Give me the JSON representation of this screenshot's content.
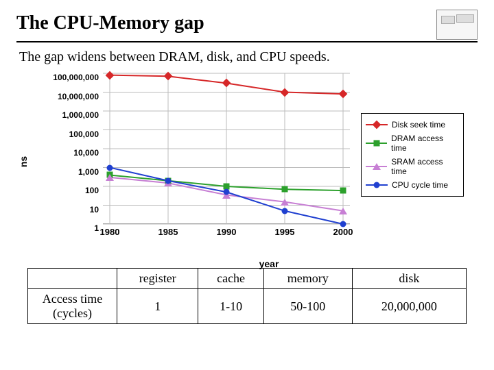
{
  "title": "The CPU-Memory gap",
  "subtitle": "The gap widens between DRAM, disk, and CPU speeds.",
  "chart_data": {
    "type": "line",
    "title": "",
    "xlabel": "year",
    "ylabel": "ns",
    "x_scale": "linear",
    "y_scale": "log",
    "ylim": [
      1,
      100000000
    ],
    "xlim": [
      1980,
      2000
    ],
    "x_ticks": [
      1980,
      1985,
      1990,
      1995,
      2000
    ],
    "y_ticks": [
      1,
      10,
      100,
      1000,
      10000,
      100000,
      1000000,
      10000000,
      100000000
    ],
    "y_tick_labels": [
      "1",
      "10",
      "100",
      "1,000",
      "10,000",
      "100,000",
      "1,000,000",
      "10,000,000",
      "100,000,000"
    ],
    "categories": [
      1980,
      1985,
      1990,
      1995,
      2000
    ],
    "series": [
      {
        "name": "Disk seek time",
        "color": "#d62728",
        "marker": "diamond",
        "values": [
          80000000,
          70000000,
          30000000,
          10000000,
          8000000
        ]
      },
      {
        "name": "DRAM access time",
        "color": "#2ca02c",
        "marker": "square",
        "values": [
          400,
          200,
          100,
          70,
          60
        ]
      },
      {
        "name": "SRAM access time",
        "color": "#c77fd4",
        "marker": "triangle",
        "values": [
          300,
          150,
          35,
          15,
          5
        ]
      },
      {
        "name": "CPU cycle time",
        "color": "#2040d0",
        "marker": "circle",
        "values": [
          1000,
          200,
          50,
          5,
          1
        ]
      }
    ],
    "legend_position": "right"
  },
  "table": {
    "row_label": "Access time (cycles)",
    "columns": [
      "register",
      "cache",
      "memory",
      "disk"
    ],
    "values": [
      "1",
      "1-10",
      "50-100",
      "20,000,000"
    ]
  }
}
